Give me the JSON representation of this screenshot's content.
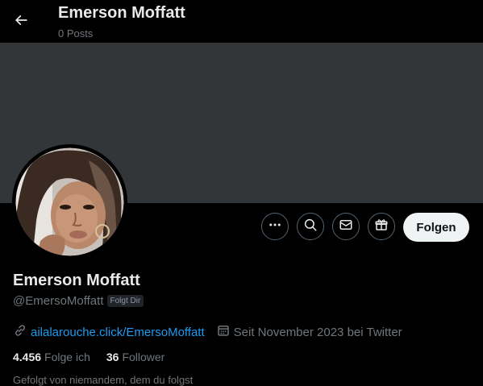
{
  "header": {
    "title": "Emerson Moffatt",
    "posts": "0 Posts"
  },
  "profile": {
    "display_name": "Emerson Moffatt",
    "handle": "@EmersoMoffatt",
    "follows_you_badge": "Folgt Dir",
    "website": "ailalarouche.click/EmersoMoffatt",
    "joined": "Seit November 2023 bei Twitter",
    "following_count": "4.456",
    "following_label": "Folge ich",
    "followers_count": "36",
    "followers_label": "Follower",
    "followed_by": "Gefolgt von niemandem, dem du folgst"
  },
  "actions": {
    "follow_label": "Folgen"
  },
  "icons": {
    "back": "arrow-left-icon",
    "more": "ellipsis-icon",
    "search": "search-icon",
    "message": "envelope-icon",
    "gift": "gift-icon",
    "link": "link-icon",
    "calendar": "calendar-icon"
  },
  "colors": {
    "background": "#000000",
    "banner": "#333639",
    "link": "#1d9bf0",
    "secondary_text": "#71767b",
    "primary_text": "#e7e9ea",
    "follow_button_bg": "#eff3f4"
  }
}
